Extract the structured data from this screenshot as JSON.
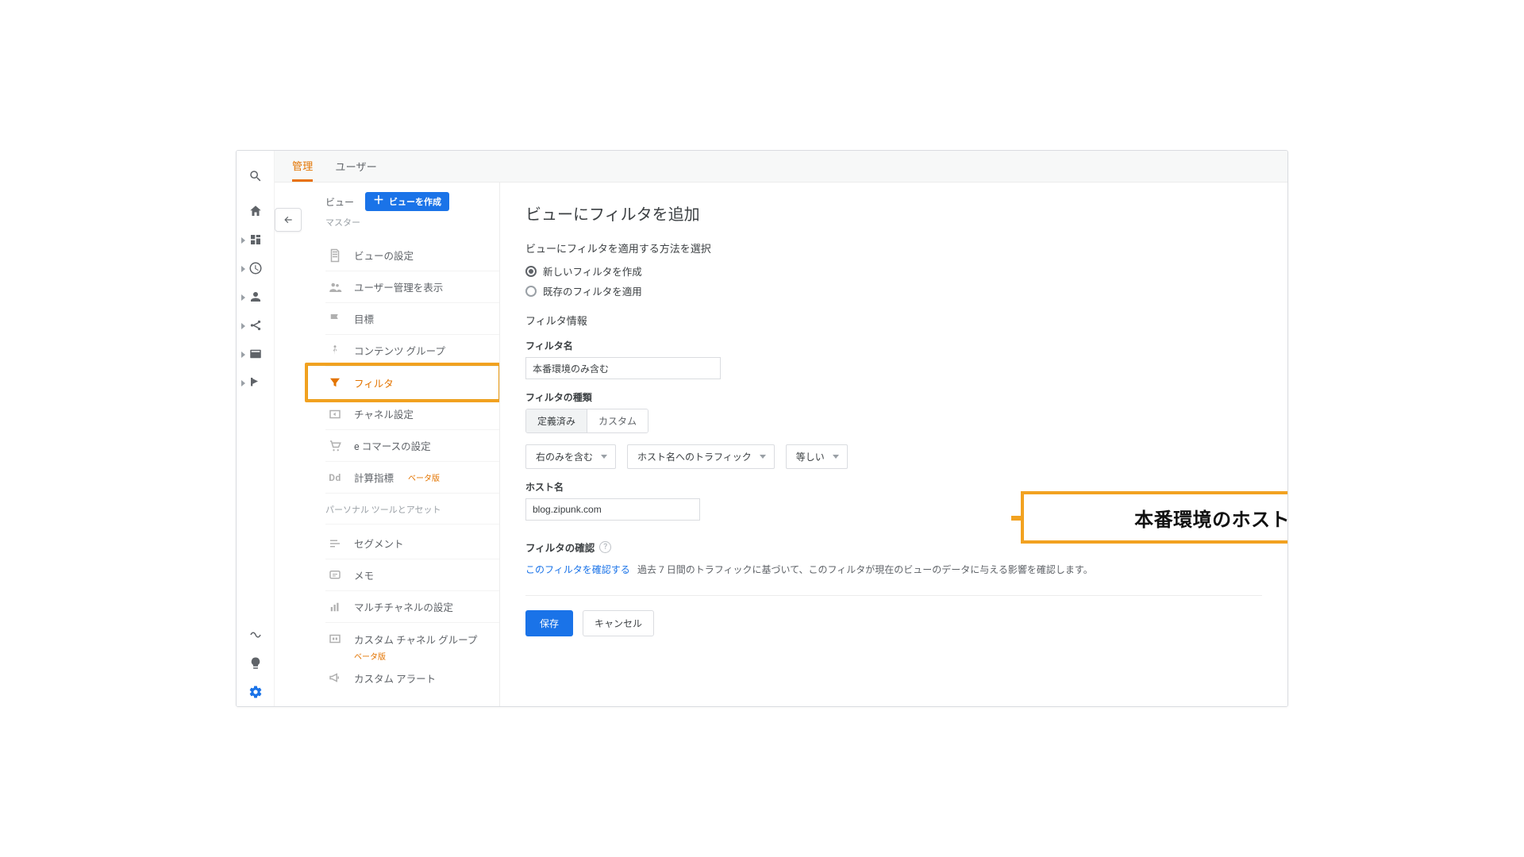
{
  "tabs": {
    "admin": "管理",
    "users": "ユーザー"
  },
  "sideNav": {
    "viewLabel": "ビュー",
    "createView": "ビューを作成",
    "master": "マスター",
    "items": [
      {
        "label": "ビューの設定"
      },
      {
        "label": "ユーザー管理を表示"
      },
      {
        "label": "目標"
      },
      {
        "label": "コンテンツ グループ"
      },
      {
        "label": "フィルタ"
      },
      {
        "label": "チャネル設定"
      },
      {
        "label": "e コマースの設定"
      },
      {
        "label": "計算指標",
        "beta": "ベータ版"
      }
    ],
    "personalHeader": "パーソナル ツールとアセット",
    "personal": [
      {
        "label": "セグメント"
      },
      {
        "label": "メモ"
      },
      {
        "label": "マルチチャネルの設定"
      },
      {
        "label": "カスタム チャネル グループ",
        "sub": "ベータ版"
      },
      {
        "label": "カスタム アラート"
      }
    ]
  },
  "content": {
    "title": "ビューにフィルタを追加",
    "methodLabel": "ビューにフィルタを適用する方法を選択",
    "radioNew": "新しいフィルタを作成",
    "radioExisting": "既存のフィルタを適用",
    "filterInfo": "フィルタ情報",
    "filterNameLabel": "フィルタ名",
    "filterNameValue": "本番環境のみ含む",
    "filterTypeLabel": "フィルタの種類",
    "typePredef": "定義済み",
    "typeCustom": "カスタム",
    "dd1": "右のみを含む",
    "dd2": "ホスト名へのトラフィック",
    "dd3": "等しい",
    "hostnameLabel": "ホスト名",
    "hostnameValue": "blog.zipunk.com",
    "verifyTitle": "フィルタの確認",
    "verifyLink": "このフィルタを確認する",
    "verifyText": "過去 7 日間のトラフィックに基づいて、このフィルタが現在のビューのデータに与える影響を確認します。",
    "save": "保存",
    "cancel": "キャンセル"
  },
  "callout": "本番環境のホスト名(ドメイン)を記入"
}
